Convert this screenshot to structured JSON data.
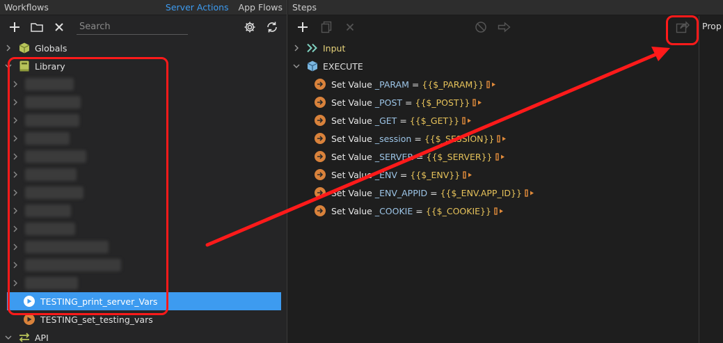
{
  "left_panel": {
    "title": "Workflows",
    "tabs": [
      {
        "label": "Server Actions",
        "active": true
      },
      {
        "label": "App Flows",
        "active": false
      }
    ],
    "search_placeholder": "Search",
    "tree": {
      "globals_label": "Globals",
      "library_label": "Library",
      "redacted_items_count": 12,
      "actions": [
        {
          "label": "TESTING_print_server_Vars",
          "selected": true
        },
        {
          "label": "TESTING_set_testing_vars",
          "selected": false
        }
      ],
      "api_label": "API"
    }
  },
  "right_panel": {
    "title": "Steps",
    "properties_label": "Prop",
    "tree": {
      "input_label": "Input",
      "execute_label": "EXECUTE",
      "statements": [
        {
          "keyword": "Set Value",
          "name": "_PARAM",
          "equals": "=",
          "value": "{{$_PARAM}}"
        },
        {
          "keyword": "Set Value",
          "name": "_POST",
          "equals": "=",
          "value": "{{$_POST}}"
        },
        {
          "keyword": "Set Value",
          "name": "_GET",
          "equals": "=",
          "value": "{{$_GET}}"
        },
        {
          "keyword": "Set Value",
          "name": "_session",
          "equals": "=",
          "value": "{{$_SESSION}}"
        },
        {
          "keyword": "Set Value",
          "name": "_SERVER",
          "equals": "=",
          "value": "{{$_SERVER}}"
        },
        {
          "keyword": "Set Value",
          "name": "_ENV",
          "equals": "=",
          "value": "{{$_ENV}}"
        },
        {
          "keyword": "Set Value",
          "name": "_ENV_APPID",
          "equals": "=",
          "value": "{{$_ENV.APP_ID}}"
        },
        {
          "keyword": "Set Value",
          "name": "_COOKIE",
          "equals": "=",
          "value": "{{$_COOKIE}}"
        }
      ]
    }
  },
  "colors": {
    "accent": "#3d9bf0",
    "action_orange": "#d9823b",
    "annotation_red": "#ff1a1a",
    "value_yellow": "#e6c25a",
    "name_blue": "#9cc4e6"
  }
}
